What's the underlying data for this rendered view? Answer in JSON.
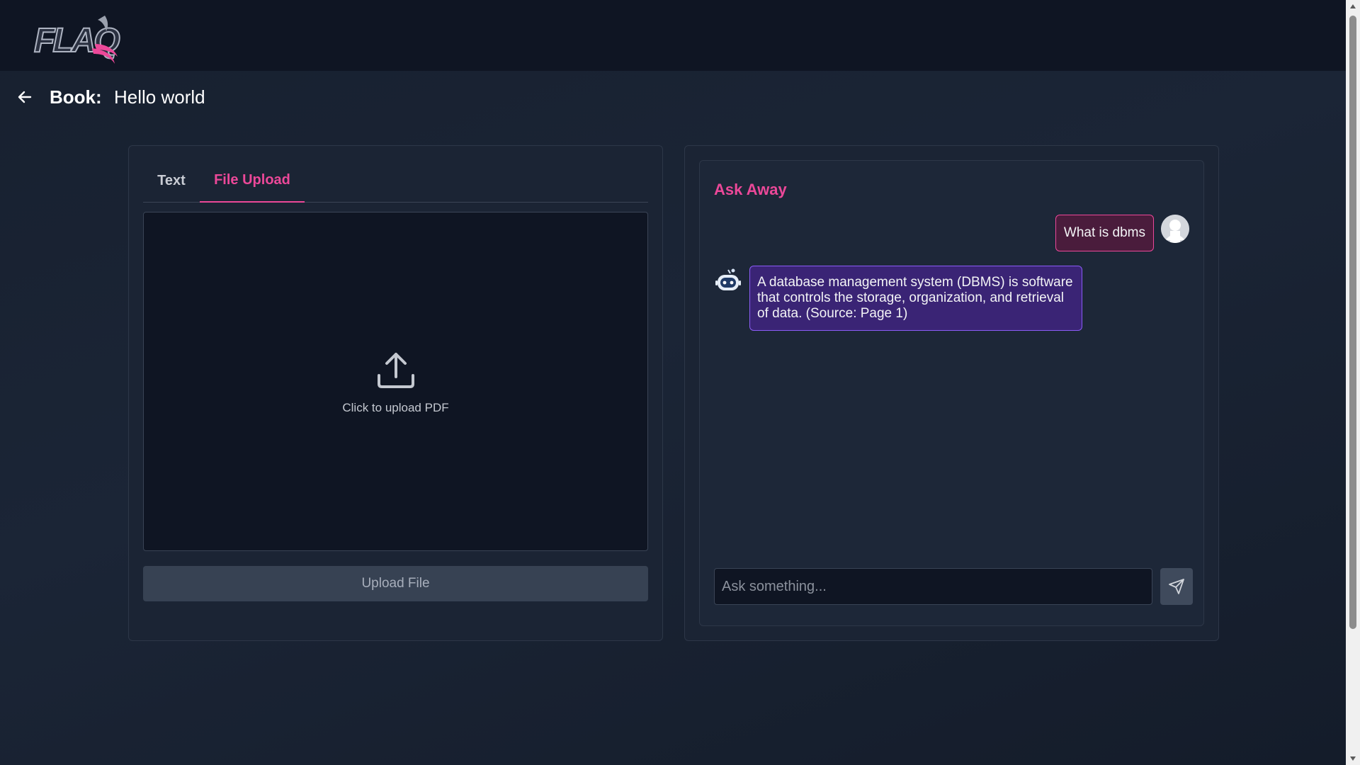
{
  "header": {
    "logo_text": "FLAQ",
    "logo_icon": "wing-logo-icon"
  },
  "page": {
    "back_icon": "arrow-left-icon",
    "book_label": "Book:",
    "book_title": "Hello world"
  },
  "upload_panel": {
    "tabs": [
      {
        "label": "Text",
        "active": false
      },
      {
        "label": "File Upload",
        "active": true
      }
    ],
    "upload_icon": "upload-icon",
    "upload_hint": "Click to upload PDF",
    "upload_button": "Upload File"
  },
  "chat": {
    "title": "Ask Away",
    "messages": [
      {
        "role": "user",
        "text": "What is dbms",
        "avatar": "user-avatar-icon"
      },
      {
        "role": "bot",
        "text": "A database management system (DBMS) is software that controls the storage, organization, and retrieval of data. (Source: Page 1)",
        "avatar": "robot-icon"
      }
    ],
    "input_placeholder": "Ask something...",
    "input_value": "",
    "send_icon": "send-icon"
  },
  "colors": {
    "accent_pink": "#ec4899",
    "accent_purple": "#8b5cf6",
    "background": "#1b2536"
  }
}
